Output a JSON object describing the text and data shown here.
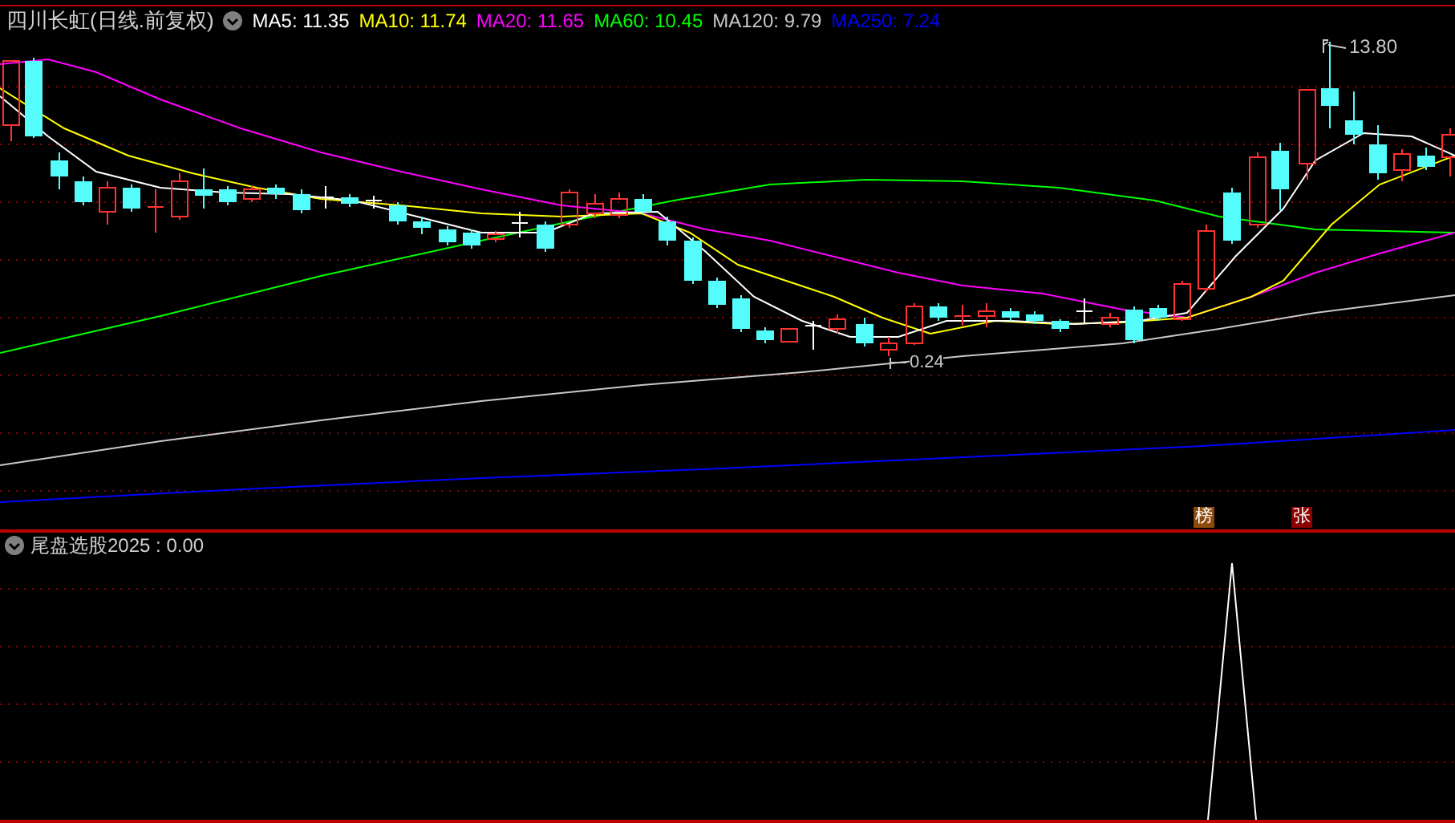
{
  "header": {
    "stock": "四川长虹",
    "period": "(日线.前复权)"
  },
  "ma_labels": [
    {
      "text": "MA5: 11.35",
      "color": "#ffffff"
    },
    {
      "text": "MA10: 11.74",
      "color": "#ffff00"
    },
    {
      "text": "MA20: 11.65",
      "color": "#ff00ff"
    },
    {
      "text": "MA60: 10.45",
      "color": "#00ff00"
    },
    {
      "text": "MA120: 9.79",
      "color": "#c8c8c8"
    },
    {
      "text": "MA250: 7.24",
      "color": "#0000ff"
    }
  ],
  "high_label": "13.80",
  "low_label": "0.24",
  "markers": [
    {
      "text": "榜",
      "color": "#8c4a0c"
    },
    {
      "text": "张",
      "color": "#8c0000"
    }
  ],
  "indicator": {
    "title": "尾盘选股2025 : 0.00"
  }
}
